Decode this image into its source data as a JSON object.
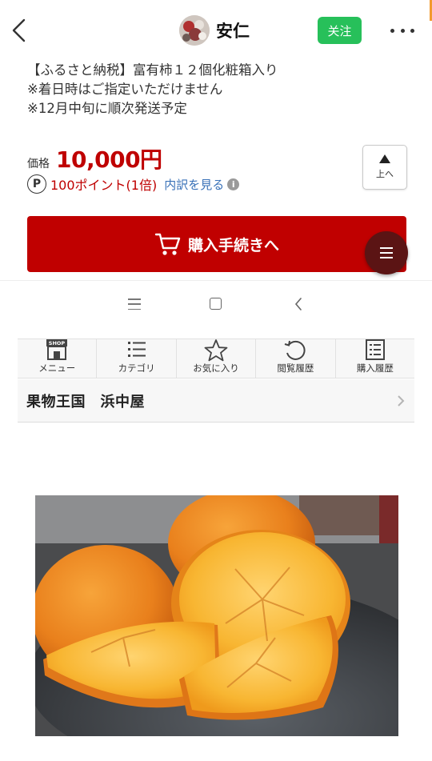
{
  "header": {
    "account_name": "安仁",
    "follow_label": "关注",
    "icons": [
      "chevron-left-icon",
      "avatar",
      "more-icon"
    ]
  },
  "product": {
    "description_lines": [
      "【ふるさと納税】富有柿１２個化粧箱入り",
      "※着日時はご指定いただけません",
      "※12月中旬に順次発送予定"
    ],
    "price_label": "価格",
    "price_value": "10,000円",
    "points_badge": "P",
    "points_text": "100ポイント(1倍)",
    "breakdown_link": "内訳を見る",
    "info_glyph": "i"
  },
  "to_top": {
    "label": "上へ"
  },
  "purchase": {
    "label": "購入手続きへ"
  },
  "shop_nav": {
    "items": [
      {
        "label": "メニュー",
        "icon": "shop-icon"
      },
      {
        "label": "カテゴリ",
        "icon": "list-icon"
      },
      {
        "label": "お気に入り",
        "icon": "star-icon"
      },
      {
        "label": "閲覧履歴",
        "icon": "history-icon"
      },
      {
        "label": "購入履歴",
        "icon": "receipt-icon"
      }
    ],
    "shop_badge_text": "SHOP"
  },
  "shop": {
    "name": "果物王国　浜中屋"
  },
  "colors": {
    "accent_red": "#bf0000",
    "button_red": "#c00000",
    "follow_green": "#27c05a",
    "link_blue": "#3a72b8",
    "fab_dark": "#5b1414"
  }
}
